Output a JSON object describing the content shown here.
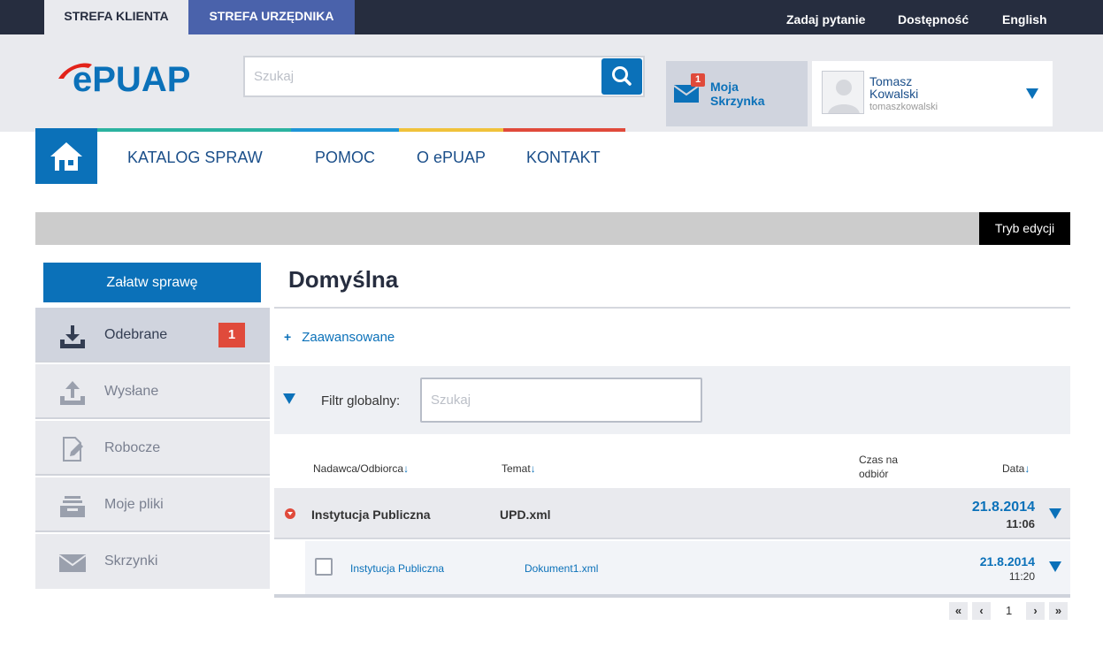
{
  "topbar": {
    "tab_client": "STREFA KLIENTA",
    "tab_clerk": "STREFA URZĘDNIKA",
    "ask": "Zadaj pytanie",
    "accessibility": "Dostępność",
    "language": "English"
  },
  "header": {
    "logo_text": "ePUAP",
    "search_placeholder": "Szukaj",
    "mailbox_label": "Moja Skrzynka",
    "mailbox_count": "1",
    "user_name": "Tomasz Kowalski",
    "user_login": "tomaszkowalski"
  },
  "nav": {
    "items": [
      "KATALOG SPRAW",
      "POMOC",
      "O ePUAP",
      "KONTAKT"
    ],
    "stripe_colors": [
      "#2bb2a0",
      "#1e95d6",
      "#f0c23b",
      "#e04a3b"
    ]
  },
  "editbar": {
    "mode_label": "Tryb edycji"
  },
  "sidebar": {
    "settle_button": "Załatw sprawę",
    "items": [
      {
        "label": "Odebrane",
        "icon": "inbox-download-icon",
        "badge": "1"
      },
      {
        "label": "Wysłane",
        "icon": "outbox-upload-icon"
      },
      {
        "label": "Robocze",
        "icon": "draft-edit-icon"
      },
      {
        "label": "Moje pliki",
        "icon": "files-tray-icon"
      },
      {
        "label": "Skrzynki",
        "icon": "envelope-icon"
      }
    ]
  },
  "main": {
    "title": "Domyślna",
    "advanced_plus": "+",
    "advanced": "Zaawansowane",
    "filter_label": "Filtr globalny:",
    "filter_placeholder": "Szukaj",
    "columns": {
      "sender": "Nadawca/Odbiorca",
      "subject": "Temat",
      "pickup_time_line1": "Czas na",
      "pickup_time_line2": "odbiór",
      "date": "Data",
      "sort_arrow": "↓"
    },
    "group_row": {
      "sender": "Instytucja Publiczna",
      "subject": "UPD.xml",
      "date": "21.8.2014",
      "time": "11:06"
    },
    "doc_row": {
      "sender": "Instytucja Publiczna",
      "subject": "Dokument1.xml",
      "date": "21.8.2014",
      "time": "11:20"
    }
  },
  "pagination": {
    "first": "«",
    "prev": "‹",
    "page": "1",
    "next": "›",
    "last": "»"
  },
  "colors": {
    "topbar": "#262d3f",
    "brand_blue": "#0b71b9",
    "clerk_tab": "#4a62ab",
    "alert_red": "#e04a3b"
  }
}
